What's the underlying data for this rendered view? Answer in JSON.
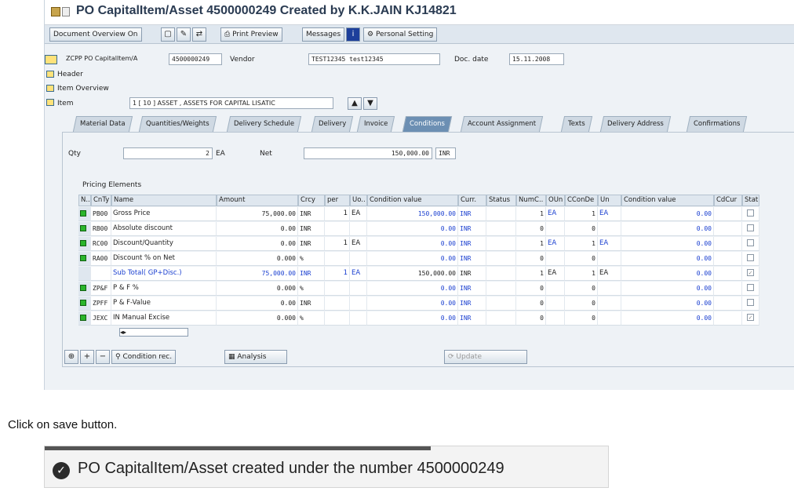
{
  "window": {
    "title": "PO CapitalItem/Asset 4500000249 Created by K.K.JAIN KJ14821"
  },
  "toolbar": {
    "doc_overview": "Document Overview On",
    "print_preview": "Print Preview",
    "messages": "Messages",
    "personal_setting": "Personal Setting"
  },
  "header": {
    "doc_type": "ZCPP PO CapitalItem/A",
    "po_number": "4500000249",
    "vendor_label": "Vendor",
    "vendor_value": "TEST12345 test12345",
    "doc_date_label": "Doc. date",
    "doc_date_value": "15.11.2008",
    "header_node": "Header",
    "item_overview_node": "Item Overview",
    "item_label": "Item",
    "item_value": "1 [ 10 ] ASSET , ASSETS FOR CAPITAL LISATIC"
  },
  "tabs": [
    "Material Data",
    "Quantities/Weights",
    "Delivery Schedule",
    "Delivery",
    "Invoice",
    "Conditions",
    "Account Assignment",
    "Texts",
    "Delivery Address",
    "Confirmations"
  ],
  "active_tab": "Conditions",
  "conditions": {
    "qty_label": "Qty",
    "qty_value": "2",
    "qty_unit": "EA",
    "net_label": "Net",
    "net_value": "150,000.00",
    "net_currency": "INR",
    "group_title": "Pricing Elements",
    "columns": [
      "N..",
      "CnTy",
      "Name",
      "Amount",
      "Crcy",
      "per",
      "Uo..",
      "Condition value",
      "Curr.",
      "Status",
      "NumC..",
      "OUn",
      "CConDe",
      "Un",
      "Condition value",
      "CdCur",
      "Stat"
    ],
    "rows": [
      {
        "cnty": "PB00",
        "name": "Gross Price",
        "amount": "75,000.00",
        "crcy": "INR",
        "per": "1",
        "uom": "EA",
        "cond_value": "150,000.00",
        "curr": "INR",
        "numc": "1",
        "oun": "EA",
        "cconde": "1",
        "un": "EA",
        "cond_value2": "0.00",
        "stat": ""
      },
      {
        "cnty": "RB00",
        "name": "Absolute discount",
        "amount": "0.00",
        "crcy": "INR",
        "per": "",
        "uom": "",
        "cond_value": "0.00",
        "curr": "INR",
        "numc": "0",
        "oun": "",
        "cconde": "0",
        "un": "",
        "cond_value2": "0.00",
        "stat": ""
      },
      {
        "cnty": "RC00",
        "name": "Discount/Quantity",
        "amount": "0.00",
        "crcy": "INR",
        "per": "1",
        "uom": "EA",
        "cond_value": "0.00",
        "curr": "INR",
        "numc": "1",
        "oun": "EA",
        "cconde": "1",
        "un": "EA",
        "cond_value2": "0.00",
        "stat": ""
      },
      {
        "cnty": "RA00",
        "name": "Discount % on Net",
        "amount": "0.000",
        "crcy": "%",
        "per": "",
        "uom": "",
        "cond_value": "0.00",
        "curr": "INR",
        "numc": "0",
        "oun": "",
        "cconde": "0",
        "un": "",
        "cond_value2": "0.00",
        "stat": ""
      },
      {
        "cnty": "",
        "name": "Sub Total( GP+Disc.)",
        "amount": "75,000.00",
        "crcy": "INR",
        "per": "1",
        "uom": "EA",
        "cond_value": "150,000.00",
        "curr": "INR",
        "numc": "1",
        "oun": "EA",
        "cconde": "1",
        "un": "EA",
        "cond_value2": "0.00",
        "stat": "✓"
      },
      {
        "cnty": "ZP&F",
        "name": "P & F %",
        "amount": "0.000",
        "crcy": "%",
        "per": "",
        "uom": "",
        "cond_value": "0.00",
        "curr": "INR",
        "numc": "0",
        "oun": "",
        "cconde": "0",
        "un": "",
        "cond_value2": "0.00",
        "stat": ""
      },
      {
        "cnty": "ZPFF",
        "name": "P & F-Value",
        "amount": "0.00",
        "crcy": "INR",
        "per": "",
        "uom": "",
        "cond_value": "0.00",
        "curr": "INR",
        "numc": "0",
        "oun": "",
        "cconde": "0",
        "un": "",
        "cond_value2": "0.00",
        "stat": ""
      },
      {
        "cnty": "JEXC",
        "name": "IN Manual Excise",
        "amount": "0.000",
        "crcy": "%",
        "per": "",
        "uom": "",
        "cond_value": "0.00",
        "curr": "INR",
        "numc": "0",
        "oun": "",
        "cconde": "0",
        "un": "",
        "cond_value2": "0.00",
        "stat": "✓"
      }
    ],
    "condition_rec": "Condition rec.",
    "analysis": "Analysis",
    "update": "Update"
  },
  "instruction": "Click on save button.",
  "status_bar": {
    "message": "PO CapitalItem/Asset created under the number 4500000249"
  }
}
